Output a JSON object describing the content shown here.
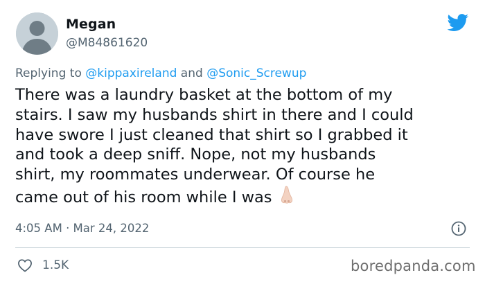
{
  "author": {
    "name": "Megan",
    "handle": "@M84861620"
  },
  "reply_to": {
    "prefix": "Replying to ",
    "mention_1": "@kippaxireland",
    "joiner": " and ",
    "mention_2": "@Sonic_Screwup"
  },
  "tweet": {
    "lines": [
      "There was a laundry basket at the bottom of my",
      "stairs. I saw my husbands shirt in there and I could",
      "have swore I just cleaned that shirt so I grabbed it",
      "and took a deep sniff. Nope, not my husbands",
      "shirt, my roommates underwear. Of course he",
      "came out of his room while I was"
    ],
    "emoji": "nose-emoji",
    "timestamp": "4:05 AM · Mar 24, 2022"
  },
  "engagement": {
    "likes": "1.5K"
  },
  "watermark": "boredpanda.com",
  "colors": {
    "twitter_blue": "#1d9bf0",
    "secondary_text": "#536471",
    "primary_text": "#0f1419",
    "divider": "#cfd9de"
  },
  "icons": [
    "avatar-placeholder-icon",
    "twitter-bird-icon",
    "info-icon",
    "heart-icon"
  ]
}
